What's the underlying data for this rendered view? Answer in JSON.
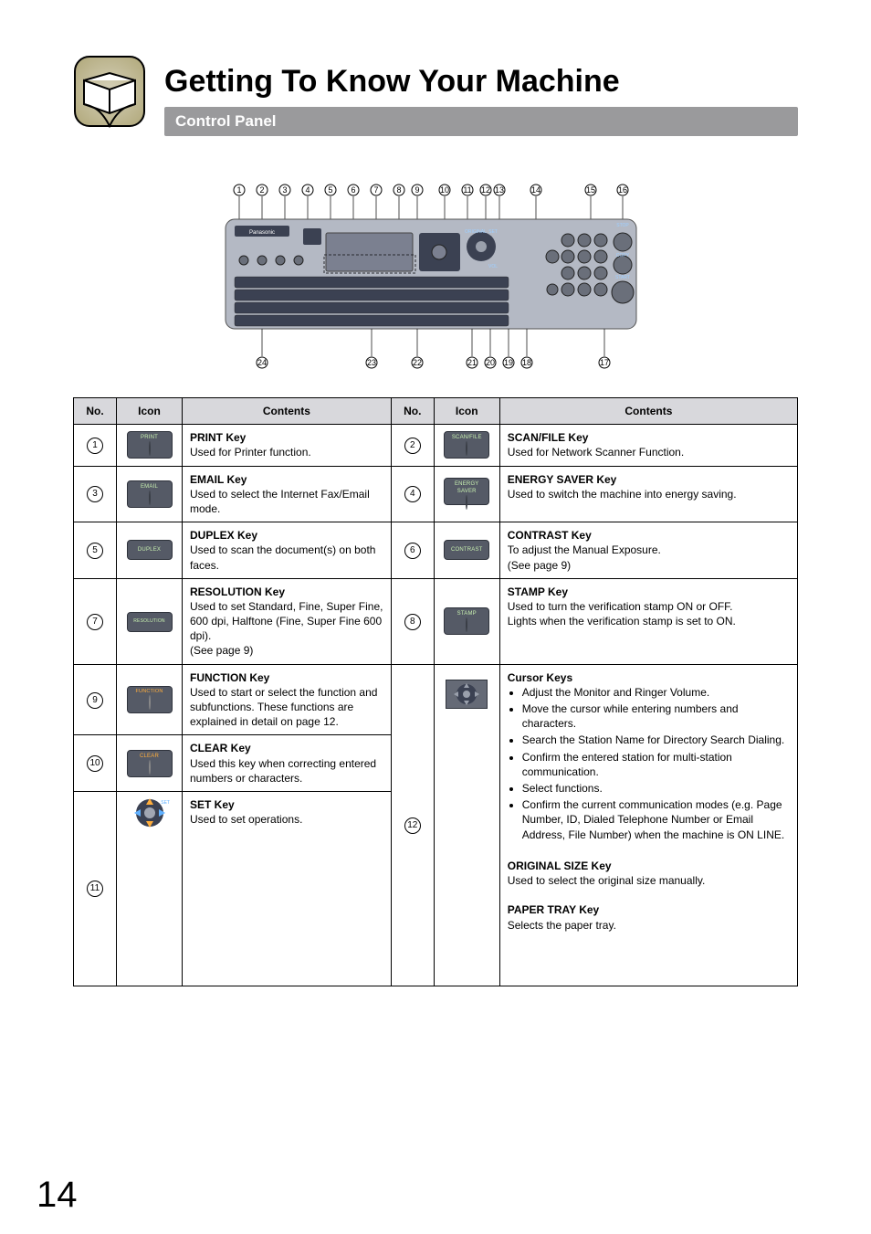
{
  "header": {
    "title": "Getting To Know Your Machine",
    "subtitle": "Control Panel"
  },
  "table": {
    "headers": [
      "No.",
      "Icon",
      "Contents",
      "No.",
      "Icon",
      "Contents"
    ],
    "rows": [
      {
        "left": {
          "no": "1",
          "icon": "PRINT",
          "title": "PRINT Key",
          "desc": "Used for Printer function."
        },
        "right": {
          "no": "2",
          "icon": "SCAN/FILE",
          "title": "SCAN/FILE Key",
          "desc": "Used for Network Scanner Function."
        }
      },
      {
        "left": {
          "no": "3",
          "icon": "EMAIL",
          "title": "EMAIL Key",
          "desc": "Used to select the Internet Fax/Email mode."
        },
        "right": {
          "no": "4",
          "icon": "ENERGY\nSAVER",
          "title": "ENERGY SAVER Key",
          "desc": "Used to switch the machine into energy saving."
        }
      },
      {
        "left": {
          "no": "5",
          "icon": "DUPLEX",
          "title": "DUPLEX Key",
          "desc": "Used to scan the document(s) on both faces."
        },
        "right": {
          "no": "6",
          "icon": "CONTRAST",
          "title": "CONTRAST Key",
          "desc": "To adjust the Manual Exposure.\n(See page 9)"
        }
      },
      {
        "left": {
          "no": "7",
          "icon": "RESOLUTION",
          "title": "RESOLUTION Key",
          "desc": "Used to set Standard, Fine, Super Fine, 600 dpi, Halftone (Fine, Super Fine 600 dpi).\n(See page 9)"
        },
        "right": {
          "no": "8",
          "icon": "STAMP",
          "title": "STAMP Key",
          "desc": "Used to turn the verification stamp ON or OFF.\nLights when the verification stamp is set to ON."
        }
      },
      {
        "left": {
          "no": "9",
          "icon": "FUNCTION",
          "title": "FUNCTION Key",
          "desc": "Used to start or select the function and subfunctions. These functions are explained in detail on page 12."
        },
        "right_row12": {
          "no": "12",
          "cursor_title": "Cursor Keys",
          "cursor_bullets": [
            "Adjust the Monitor and Ringer Volume.",
            "Move the cursor while entering numbers and characters.",
            "Search the Station Name for Directory Search Dialing.",
            "Confirm the entered station for multi-station communication.",
            "Select functions.",
            "Confirm the current communication modes (e.g. Page Number, ID, Dialed Telephone Number or Email Address, File Number) when the machine is ON LINE."
          ],
          "orig_title": "ORIGINAL SIZE Key",
          "orig_desc": "Used to select the original size manually.",
          "paper_title": "PAPER TRAY Key",
          "paper_desc": "Selects the paper tray."
        }
      },
      {
        "left": {
          "no": "10",
          "icon": "CLEAR",
          "title": "CLEAR Key",
          "desc": "Used this key when correcting entered numbers or characters."
        }
      },
      {
        "left": {
          "no": "11",
          "icon": "SET-DIAL",
          "title": "SET Key",
          "desc": "Used to set operations."
        }
      }
    ]
  },
  "page_number": "14"
}
